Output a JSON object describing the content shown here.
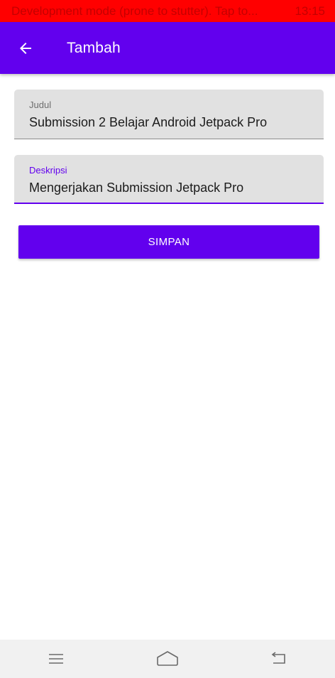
{
  "status_bar": {
    "message": "Development mode (prone to stutter). Tap to...",
    "time": "13:15",
    "background": "#ff0000"
  },
  "app_bar": {
    "back_icon": "arrow-left-icon",
    "title": "Tambah",
    "color": "#6200ee"
  },
  "form": {
    "title_field": {
      "label": "Judul",
      "value": "Submission 2 Belajar Android Jetpack Pro"
    },
    "description_field": {
      "label": "Deskripsi",
      "value": "Mengerjakan Submission Jetpack Pro"
    },
    "save_button": "SIMPAN"
  },
  "nav_bar": {
    "menu_icon": "menu-icon",
    "home_icon": "home-icon",
    "back_icon": "back-icon"
  }
}
